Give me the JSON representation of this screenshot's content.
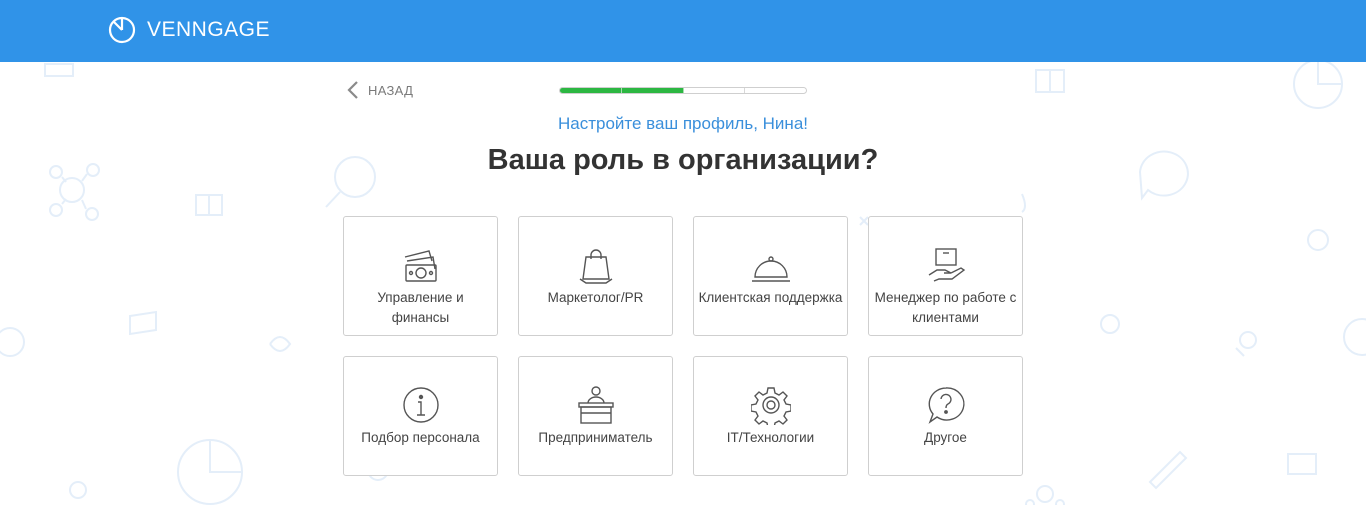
{
  "header": {
    "brand": "VENNGAGE",
    "bar_color": "#3093e8"
  },
  "nav": {
    "back_label": "НАЗАД"
  },
  "progress": {
    "steps_total": 4,
    "steps_done": 2,
    "done_color": "#2cb742"
  },
  "main": {
    "subtitle": "Настройте ваш профиль, Нина!",
    "title": "Ваша роль в организации?"
  },
  "roles": [
    {
      "line1": "Управление",
      "line2": "и финансы",
      "icon": "money-icon"
    },
    {
      "line1": "Маркетолог/PR",
      "line2": "",
      "icon": "shopping-bag-icon"
    },
    {
      "line1": "Клиентская",
      "line2": "поддержка",
      "icon": "service-bell-icon"
    },
    {
      "line1": "Менеджер по работе",
      "line2": "с клиентами",
      "icon": "hand-package-icon"
    },
    {
      "line1": "Подбор",
      "line2": "персонала",
      "icon": "info-icon"
    },
    {
      "line1": "Предприниматель",
      "line2": "",
      "icon": "desk-person-icon"
    },
    {
      "line1": "IT/Технологии",
      "line2": "",
      "icon": "gear-icon"
    },
    {
      "line1": "Другое",
      "line2": "",
      "icon": "question-bubble-icon"
    }
  ]
}
